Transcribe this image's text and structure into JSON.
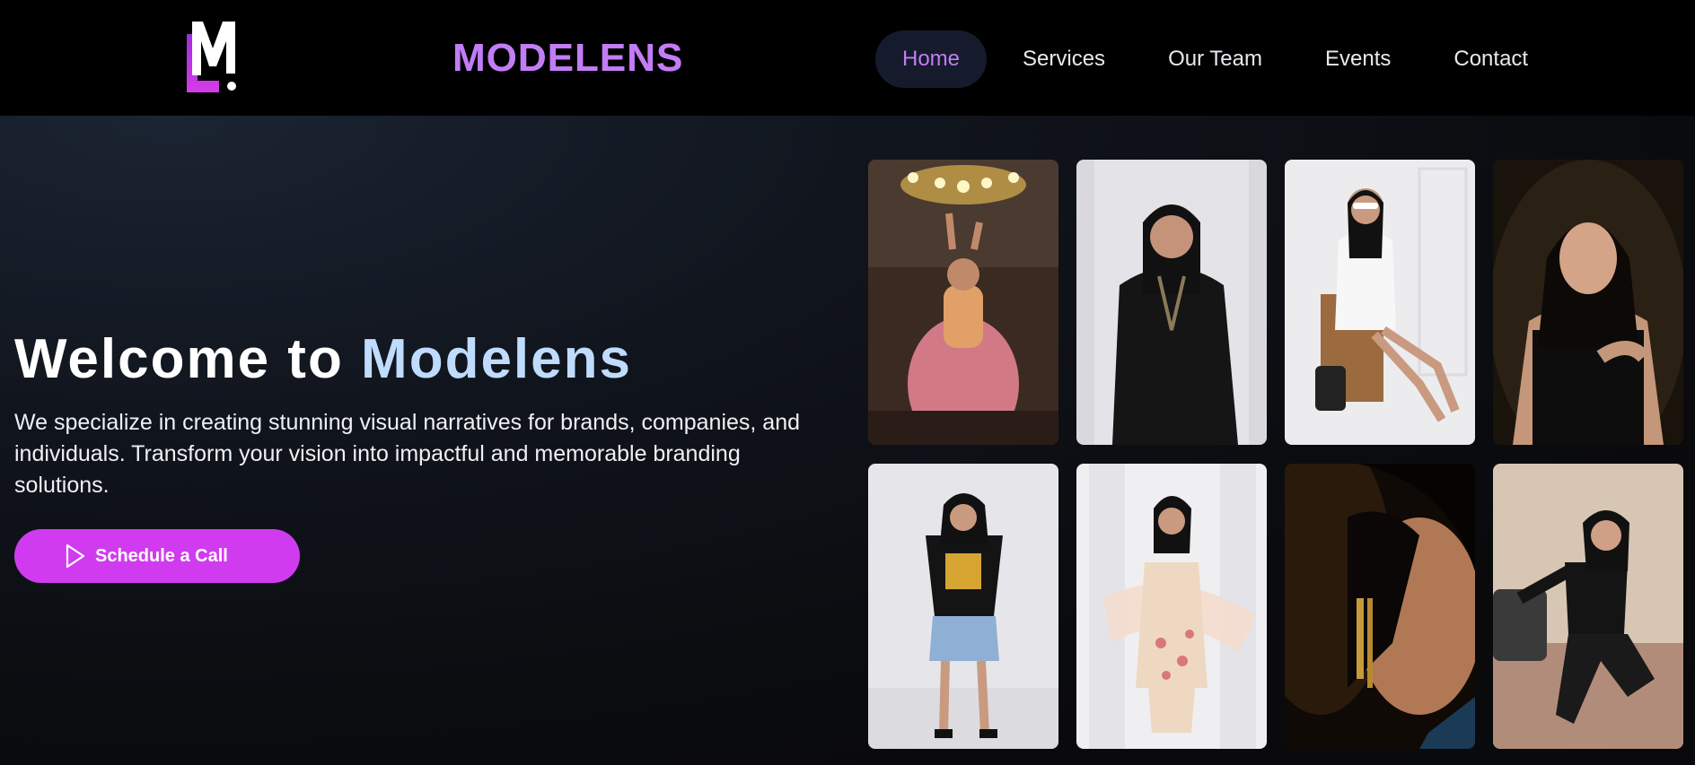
{
  "header": {
    "logo": {
      "icon": "ml-logo-icon",
      "text": "ML"
    },
    "brand": "MODELENS",
    "nav": [
      {
        "label": "Home",
        "active": true
      },
      {
        "label": "Services",
        "active": false
      },
      {
        "label": "Our Team",
        "active": false
      },
      {
        "label": "Events",
        "active": false
      },
      {
        "label": "Contact",
        "active": false
      }
    ]
  },
  "hero": {
    "title_part1": "Welcome to",
    "title_part2": "Modelens",
    "description": "We specialize in creating stunning visual narratives for brands, companies, and individuals. Transform your vision into impactful and memorable branding solutions.",
    "cta_label": "Schedule a Call",
    "cta_icon": "play-icon"
  },
  "gallery": [
    {
      "name": "photo-bridal-chandelier"
    },
    {
      "name": "photo-black-kurta"
    },
    {
      "name": "photo-white-dress-chair"
    },
    {
      "name": "photo-black-top-portrait"
    },
    {
      "name": "photo-tshirt-shorts"
    },
    {
      "name": "photo-peach-suit"
    },
    {
      "name": "photo-earring-closeup"
    },
    {
      "name": "photo-leather-pants"
    }
  ],
  "colors": {
    "accent": "#c27cf5",
    "cta": "#d13bf0",
    "title_highlight": "#bfdcff",
    "nav_active_bg": "#151b2c"
  }
}
